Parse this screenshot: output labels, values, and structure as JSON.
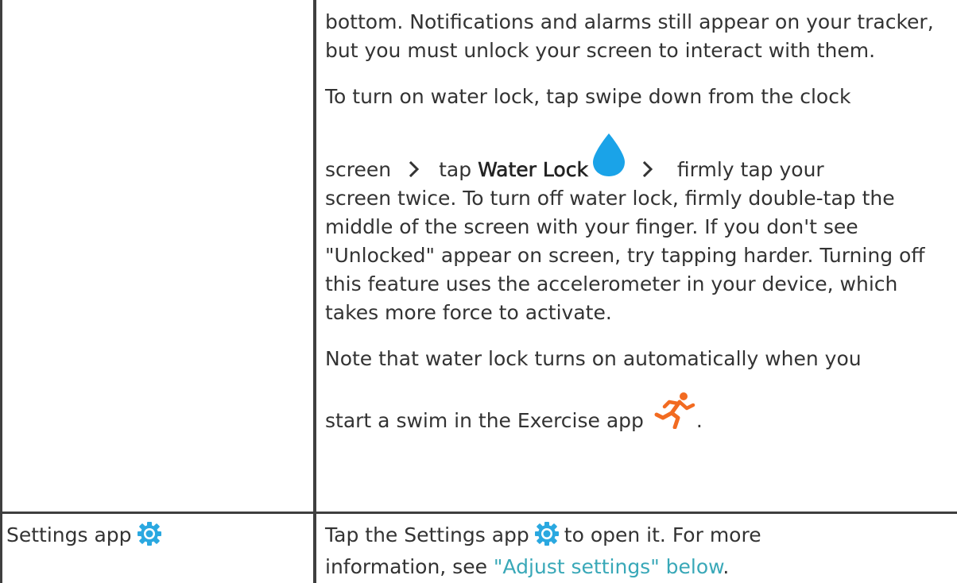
{
  "table": {
    "row1": {
      "left_text": "",
      "p1": "bottom. Notifications and alarms still appear on your tracker, but you must unlock your screen to interact with them.",
      "p2_part1": "To turn on water lock, tap swipe down from the clock",
      "p2_part2": "screen",
      "p2_part3": "tap",
      "p2_term": "Water Lock",
      "p2_part4": "firmly tap your",
      "p2_part5": "screen twice. To turn off water lock, firmly double-tap the middle of the screen with your finger. If you don't see \"Unlocked\" appear on screen, try tapping harder. Turning off this feature uses the accelerometer in your device, which takes more force to activate.",
      "p3_part1": "Note that water lock turns on automatically when you",
      "p3_part2": "start a swim in the Exercise app",
      "p3_end": "."
    },
    "row2": {
      "left_text": "Settings app",
      "right_part1": "Tap the Settings app",
      "right_part2": "to open it. For more",
      "right_part3": "information, see",
      "right_link": "\"Adjust settings\" below",
      "right_end": "."
    }
  },
  "icons": {
    "chevron": "chevron-right-icon",
    "water_drop": "water-drop-icon",
    "settings_gear": "settings-gear-icon",
    "exercise_runner": "running-person-icon"
  },
  "colors": {
    "text": "#333333",
    "link": "#39a8b8",
    "water_drop": "#1aa3e8",
    "gear": "#2aa8e0",
    "runner": "#f26b21",
    "border": "#3f3f3f"
  }
}
